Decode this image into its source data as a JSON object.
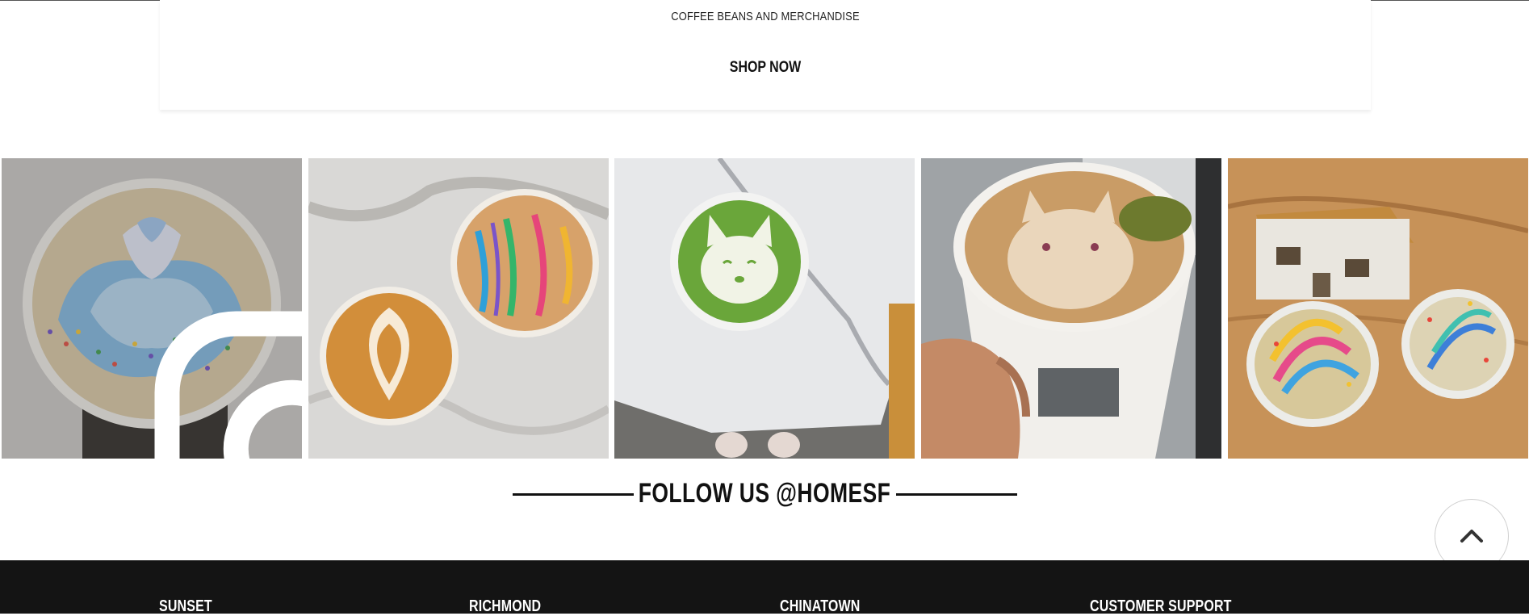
{
  "promo": {
    "subtitle": "COFFEE BEANS AND MERCHANDISE",
    "cta_label": "SHOP NOW"
  },
  "gallery": {
    "items": [
      {
        "name": "rainbow-latte-sprinkles",
        "icon": "instagram-icon"
      },
      {
        "name": "two-lattes-marble"
      },
      {
        "name": "matcha-cat-latte"
      },
      {
        "name": "totoro-latte-cup"
      },
      {
        "name": "rainbow-lattes-house"
      }
    ]
  },
  "follow": {
    "label": "FOLLOW US @HOMESF"
  },
  "scroll_top": {
    "icon": "chevron-up-icon"
  },
  "footer": {
    "columns": [
      "SUNSET",
      "RICHMOND",
      "CHINATOWN",
      "CUSTOMER SUPPORT"
    ]
  },
  "colors": {
    "footer_bg": "#141414",
    "text": "#111111",
    "background": "#ffffff"
  }
}
